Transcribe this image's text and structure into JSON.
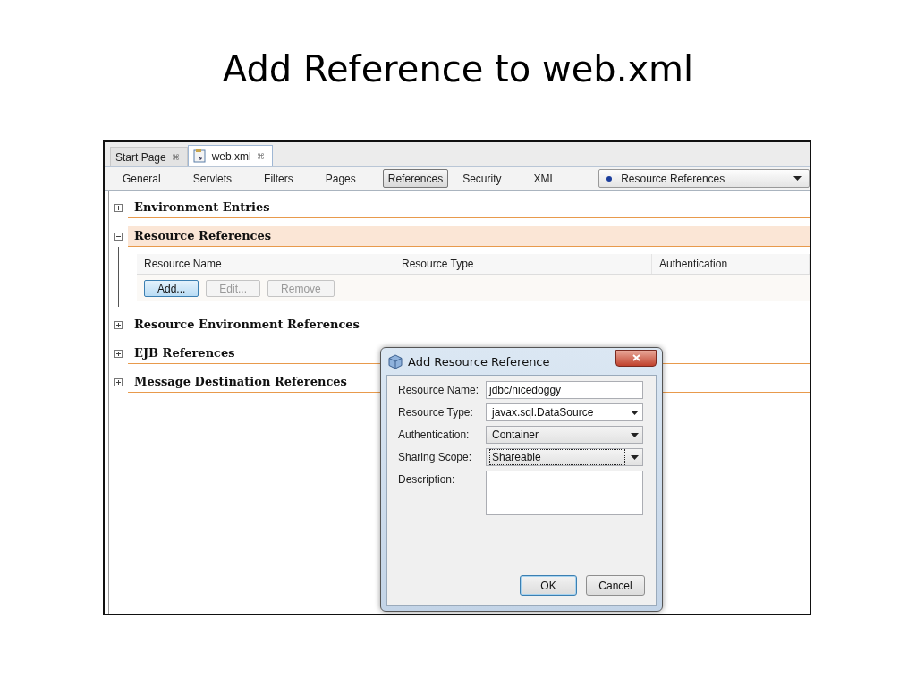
{
  "slide_title": "Add Reference to web.xml",
  "editor_tabs": [
    {
      "label": "Start Page",
      "selected": false,
      "kind": "page",
      "close": "⌘"
    },
    {
      "label": "web.xml",
      "selected": true,
      "kind": "file",
      "close": "⌘"
    }
  ],
  "view_tabs": [
    {
      "label": "General",
      "selected": false
    },
    {
      "label": "Servlets",
      "selected": false
    },
    {
      "label": "Filters",
      "selected": false
    },
    {
      "label": "Pages",
      "selected": false
    },
    {
      "label": "References",
      "selected": true
    },
    {
      "label": "Security",
      "selected": false
    },
    {
      "label": "XML",
      "selected": false
    }
  ],
  "section_dropdown": {
    "value": "Resource References"
  },
  "sections": [
    {
      "title": "Environment Entries",
      "expanded": false
    },
    {
      "title": "Resource References",
      "expanded": true,
      "columns": [
        "Resource Name",
        "Resource Type",
        "Authentication"
      ],
      "buttons": [
        {
          "label": "Add...",
          "disabled": false,
          "default": true
        },
        {
          "label": "Edit...",
          "disabled": true,
          "default": false
        },
        {
          "label": "Remove",
          "disabled": true,
          "default": false
        }
      ]
    },
    {
      "title": "Resource Environment References",
      "expanded": false
    },
    {
      "title": "EJB References",
      "expanded": false
    },
    {
      "title": "Message Destination References",
      "expanded": false
    }
  ],
  "dialog": {
    "title": "Add Resource Reference",
    "fields": [
      {
        "label": "Resource Name:",
        "kind": "text",
        "value": "jdbc/nicedoggy"
      },
      {
        "label": "Resource Type:",
        "kind": "combo",
        "value": "javax.sql.DataSource"
      },
      {
        "label": "Authentication:",
        "kind": "select",
        "value": "Container",
        "focused": false
      },
      {
        "label": "Sharing Scope:",
        "kind": "select",
        "value": "Shareable",
        "focused": true
      },
      {
        "label": "Description:",
        "kind": "textarea"
      }
    ],
    "buttons": [
      {
        "label": "OK",
        "default": true
      },
      {
        "label": "Cancel",
        "default": false
      }
    ]
  }
}
